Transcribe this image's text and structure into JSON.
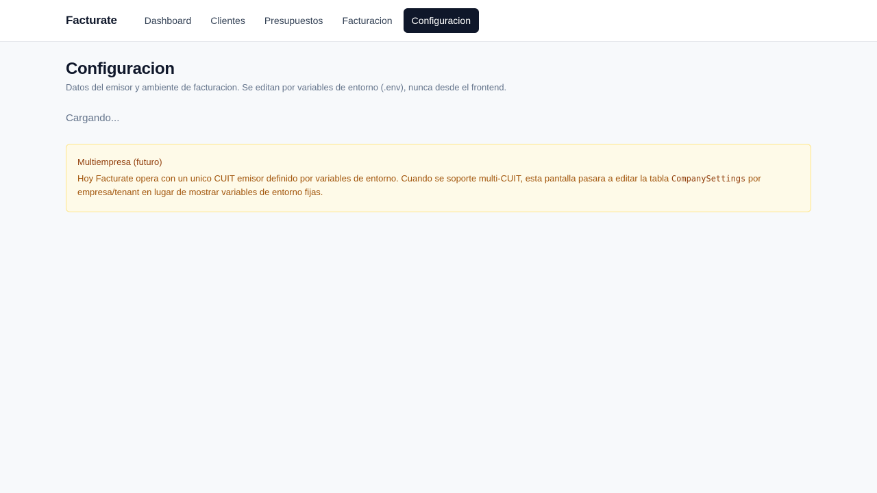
{
  "header": {
    "brand": "Facturate",
    "nav": [
      {
        "label": "Dashboard",
        "active": false
      },
      {
        "label": "Clientes",
        "active": false
      },
      {
        "label": "Presupuestos",
        "active": false
      },
      {
        "label": "Facturacion",
        "active": false
      },
      {
        "label": "Configuracion",
        "active": true
      }
    ]
  },
  "page": {
    "title": "Configuracion",
    "subtitle": "Datos del emisor y ambiente de facturacion. Se editan por variables de entorno (.env), nunca desde el frontend.",
    "loading_text": "Cargando..."
  },
  "notice": {
    "title": "Multiempresa (futuro)",
    "body_part1": "Hoy Facturate opera con un unico CUIT emisor definido por variables de entorno. Cuando se soporte multi-CUIT, esta pantalla pasara a editar la tabla ",
    "code": "CompanySettings",
    "body_part2": " por empresa/tenant en lugar de mostrar variables de entorno fijas."
  },
  "colors": {
    "active_nav_bg": "#0f172a",
    "notice_bg": "#fefae8",
    "notice_border": "#fde68a",
    "notice_text": "#92400e"
  }
}
